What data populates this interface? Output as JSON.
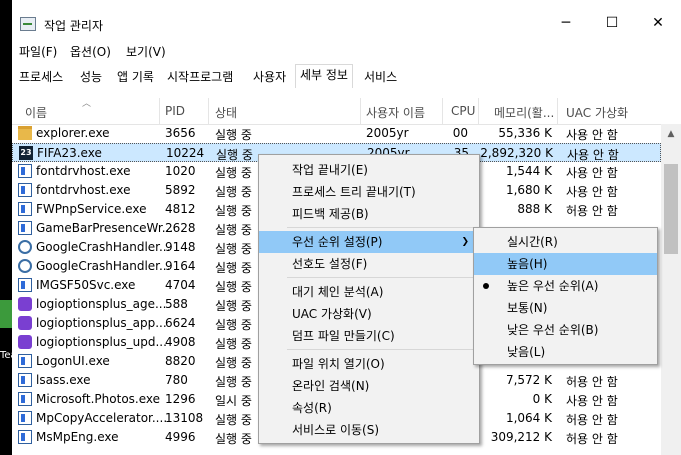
{
  "desktop": {
    "label": "Tea"
  },
  "window": {
    "title": "작업 관리자",
    "controls": {
      "minimize": "─",
      "maximize": "☐",
      "close": "✕"
    }
  },
  "menu": [
    "파일(F)",
    "옵션(O)",
    "보기(V)"
  ],
  "tabs": [
    "프로세스",
    "성능",
    "앱 기록",
    "시작프로그램",
    "사용자",
    "세부 정보",
    "서비스"
  ],
  "active_tab": "세부 정보",
  "columns": [
    "이름",
    "PID",
    "상태",
    "사용자 이름",
    "CPU",
    "메모리(활...",
    "UAC 가상화"
  ],
  "rows": [
    {
      "icon": "folder-icon",
      "name": "explorer.exe",
      "pid": "3656",
      "status": "실행 중",
      "user": "2005yr",
      "cpu": "00",
      "mem": "55,336 K",
      "uac": "사용 안 함"
    },
    {
      "icon": "fifa-icon",
      "name": "FIFA23.exe",
      "pid": "10224",
      "status": "실행 중",
      "user": "2005yr",
      "cpu": "35",
      "mem": "2,892,320 K",
      "uac": "사용 안 함"
    },
    {
      "icon": "service-icon",
      "name": "fontdrvhost.exe",
      "pid": "1020",
      "status": "실행 중",
      "user": "",
      "cpu": "",
      "mem": "1,544 K",
      "uac": "사용 안 함"
    },
    {
      "icon": "service-icon",
      "name": "fontdrvhost.exe",
      "pid": "5892",
      "status": "실행 중",
      "user": "",
      "cpu": "",
      "mem": "1,680 K",
      "uac": "사용 안 함"
    },
    {
      "icon": "service-icon",
      "name": "FWPnpService.exe",
      "pid": "4812",
      "status": "실행 중",
      "user": "",
      "cpu": "",
      "mem": "888 K",
      "uac": "허용 안 함"
    },
    {
      "icon": "service-icon",
      "name": "GameBarPresenceWr...",
      "pid": "2628",
      "status": "실행 중",
      "user": "",
      "cpu": "",
      "mem": "",
      "uac": ""
    },
    {
      "icon": "gear-icon",
      "name": "GoogleCrashHandler...",
      "pid": "9148",
      "status": "실행 중",
      "user": "",
      "cpu": "",
      "mem": "",
      "uac": ""
    },
    {
      "icon": "gear-icon",
      "name": "GoogleCrashHandler...",
      "pid": "9164",
      "status": "실행 중",
      "user": "",
      "cpu": "",
      "mem": "",
      "uac": ""
    },
    {
      "icon": "service-icon",
      "name": "IMGSF50Svc.exe",
      "pid": "4704",
      "status": "실행 중",
      "user": "",
      "cpu": "",
      "mem": "",
      "uac": ""
    },
    {
      "icon": "logi-icon",
      "name": "logioptionsplus_age...",
      "pid": "588",
      "status": "실행 중",
      "user": "",
      "cpu": "",
      "mem": "",
      "uac": ""
    },
    {
      "icon": "logi-icon",
      "name": "logioptionsplus_app...",
      "pid": "6624",
      "status": "실행 중",
      "user": "",
      "cpu": "",
      "mem": "",
      "uac": ""
    },
    {
      "icon": "logi-icon",
      "name": "logioptionsplus_upd...",
      "pid": "4908",
      "status": "실행 중",
      "user": "",
      "cpu": "",
      "mem": "",
      "uac": ""
    },
    {
      "icon": "service-icon",
      "name": "LogonUI.exe",
      "pid": "8820",
      "status": "실행 중",
      "user": "",
      "cpu": "",
      "mem": "",
      "uac": ""
    },
    {
      "icon": "service-icon",
      "name": "lsass.exe",
      "pid": "780",
      "status": "실행 중",
      "user": "",
      "cpu": "",
      "mem": "7,572 K",
      "uac": "허용 안 함"
    },
    {
      "icon": "service-icon",
      "name": "Microsoft.Photos.exe",
      "pid": "1296",
      "status": "일시 중",
      "user": "",
      "cpu": "",
      "mem": "0 K",
      "uac": "사용 안 함"
    },
    {
      "icon": "service-icon",
      "name": "MpCopyAccelerator....",
      "pid": "13108",
      "status": "실행 중",
      "user": "",
      "cpu": "",
      "mem": "1,064 K",
      "uac": "허용 안 함"
    },
    {
      "icon": "service-icon",
      "name": "MsMpEng.exe",
      "pid": "4996",
      "status": "실행 중",
      "user": "",
      "cpu": "",
      "mem": "309,212 K",
      "uac": "허용 안 함"
    }
  ],
  "context_menu": [
    "작업 끝내기(E)",
    "프로세스 트리 끝내기(T)",
    "피드백 제공(B)",
    "우선 순위 설정(P)",
    "선호도 설정(F)",
    "대기 체인 분석(A)",
    "UAC 가상화(V)",
    "덤프 파일 만들기(C)",
    "파일 위치 열기(O)",
    "온라인 검색(N)",
    "속성(R)",
    "서비스로 이동(S)"
  ],
  "priority_submenu": [
    "실시간(R)",
    "높음(H)",
    "높은 우선 순위(A)",
    "보통(N)",
    "낮은 우선 순위(B)",
    "낮음(L)"
  ],
  "checked_priority": "높은 우선 순위(A)",
  "colors": {
    "selection": "#cce8ff",
    "menu_highlight": "#91c9f7",
    "menu_bg": "#f2f2f2"
  }
}
